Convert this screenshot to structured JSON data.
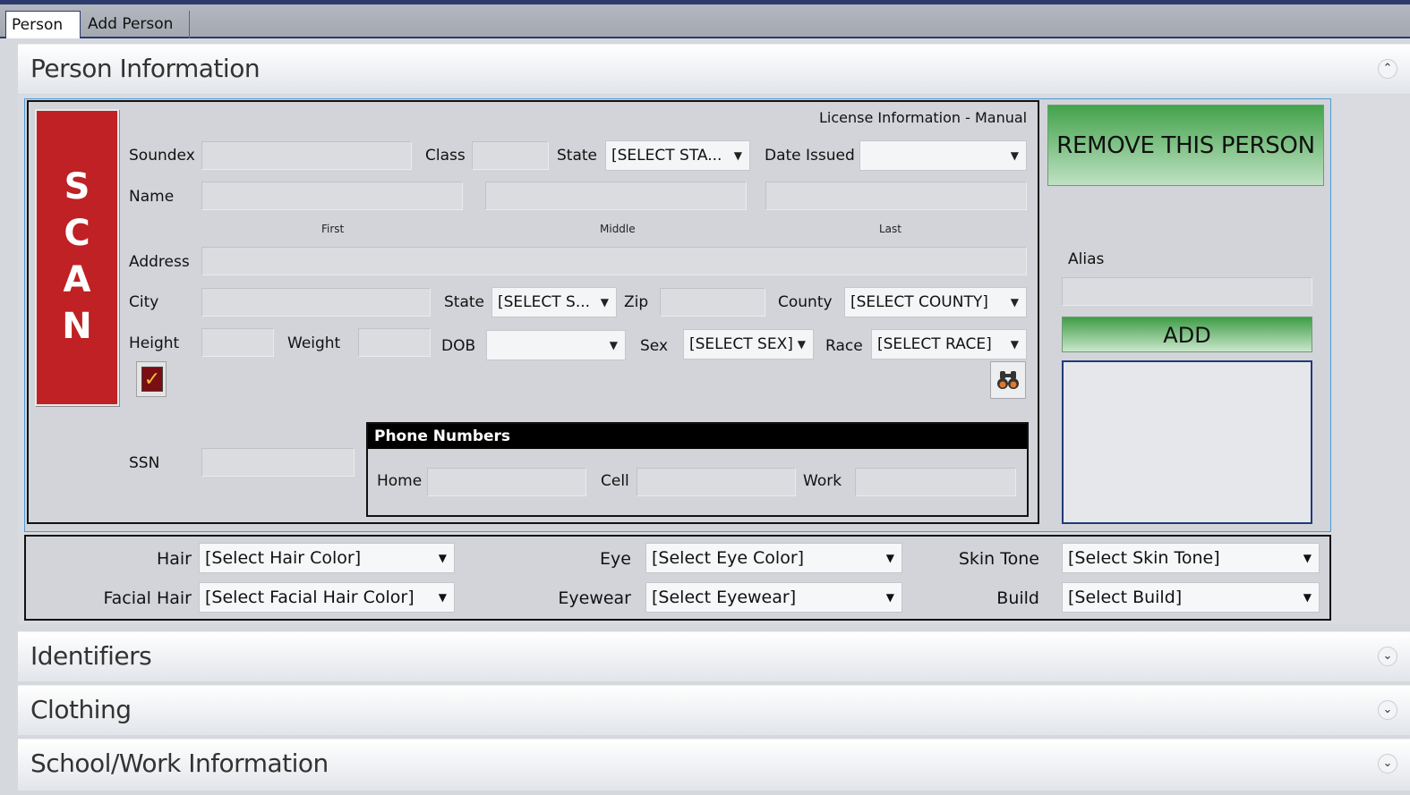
{
  "tabs": [
    {
      "label": "Person 1"
    },
    {
      "label": "Add Person +"
    }
  ],
  "sections": {
    "person_information": "Person Information",
    "identifiers": "Identifiers",
    "clothing": "Clothing",
    "school_work": "School/Work Information"
  },
  "icons": {
    "collapse": "chevron-up-double-icon",
    "expand": "chevron-down-double-icon",
    "binoculars": "binoculars-icon",
    "checkmark": "checkmark-icon"
  },
  "license": {
    "header": "License Information - Manual",
    "scan_letters": [
      "S",
      "C",
      "A",
      "N"
    ],
    "labels": {
      "soundex": "Soundex",
      "class": "Class",
      "state": "State",
      "date_issued": "Date Issued",
      "name": "Name",
      "first": "First",
      "middle": "Middle",
      "last": "Last",
      "address": "Address",
      "city": "City",
      "state2": "State",
      "zip": "Zip",
      "county": "County",
      "height": "Height",
      "weight": "Weight",
      "dob": "DOB",
      "sex": "Sex",
      "race": "Race",
      "ssn": "SSN"
    },
    "values": {
      "soundex": "",
      "class": "",
      "state": "[SELECT STA...",
      "date_issued": "",
      "first": "",
      "middle": "",
      "last": "",
      "address": "",
      "city": "",
      "state2": "[SELECT S...",
      "zip": "",
      "county": "[SELECT COUNTY]",
      "height": "",
      "weight": "",
      "dob": "",
      "sex": "[SELECT SEX]",
      "race": "[SELECT RACE]",
      "ssn": ""
    }
  },
  "phone": {
    "title": "Phone Numbers",
    "home_label": "Home",
    "cell_label": "Cell",
    "work_label": "Work",
    "home": "",
    "cell": "",
    "work": ""
  },
  "right": {
    "remove_label": "REMOVE THIS PERSON",
    "alias_label": "Alias",
    "alias_value": "",
    "add_label": "ADD"
  },
  "descriptors": {
    "hair_label": "Hair",
    "hair": "[Select Hair Color]",
    "facial_hair_label": "Facial Hair",
    "facial_hair": "[Select Facial Hair Color]",
    "eye_label": "Eye",
    "eye": "[Select Eye Color]",
    "eyewear_label": "Eyewear",
    "eyewear": "[Select Eyewear]",
    "skin_label": "Skin Tone",
    "skin": "[Select Skin Tone]",
    "build_label": "Build",
    "build": "[Select Build]"
  },
  "colors": {
    "scan_red": "#bf2124",
    "button_green": "#43a34b",
    "tab_border": "#2c3a6e"
  }
}
